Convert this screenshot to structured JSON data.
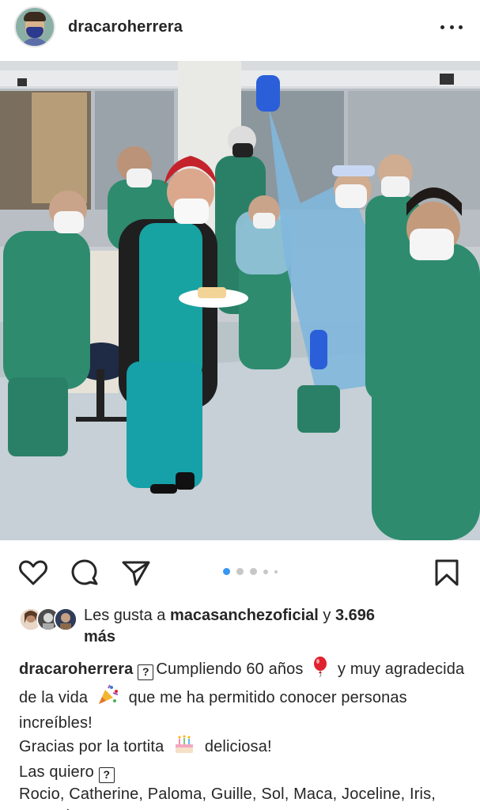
{
  "post": {
    "username": "dracaroherrera",
    "more_label": "more-options"
  },
  "carousel": {
    "current": 1,
    "total": 5
  },
  "likes": {
    "prefix": "Les gusta a ",
    "user": "macasanchezoficial",
    "middle": " y ",
    "count": "3.696",
    "suffix": "más"
  },
  "caption": {
    "username": "dracaroherrera",
    "unknown_glyph": "?",
    "part1": "Cumpliendo 60 años",
    "part2": "y muy agradecida de la vida",
    "part3": "que me ha permitido conocer personas increíbles!",
    "line2a": "Gracias por la tortita",
    "line2b": "deliciosa!",
    "line3": "Las quiero",
    "line4": "Rocio, Catherine, Paloma, Guille, Sol, Maca, Joceline, Iris, Gonzalo"
  },
  "icons": {
    "like": "heart-icon",
    "comment": "comment-icon",
    "share": "send-icon",
    "save": "bookmark-icon",
    "balloon": "balloon-emoji",
    "party": "party-popper-emoji",
    "cake": "birthday-cake-emoji"
  },
  "colors": {
    "text": "#262626",
    "carousel_active": "#3897f0",
    "carousel_inactive": "#c7c7c7",
    "scrubs": "#2e8b6e",
    "gown": "#7fb7dc"
  }
}
